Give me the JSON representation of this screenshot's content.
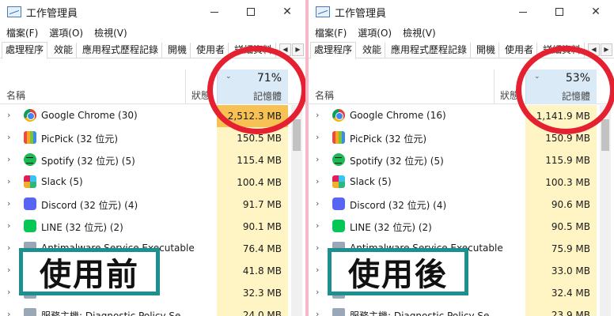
{
  "window": {
    "title": "工作管理員",
    "minimize_glyph": "—",
    "close_glyph": "✕"
  },
  "menu": [
    "檔案(F)",
    "選項(O)",
    "檢視(V)"
  ],
  "tabs": [
    "處理程序",
    "效能",
    "應用程式歷程記錄",
    "開機",
    "使用者",
    "詳細資料"
  ],
  "columns": {
    "name": "名稱",
    "status": "狀態",
    "memory": "記憶體"
  },
  "colors": {
    "memory_header": "#dbeaf7",
    "memory_cell": "#fff4c4",
    "memory_cell_hot": "#f7c253",
    "circle": "#e52030",
    "stamp_border": "#1d8f8f",
    "divider": "#f6b8c8"
  },
  "panels": [
    {
      "memory_percent": "71%",
      "label": "使用前",
      "processes": [
        {
          "name": "Google Chrome (30)",
          "memory": "2,512.3 MB",
          "icon": "chrome-icon",
          "hot": true
        },
        {
          "name": "PicPick (32 位元)",
          "memory": "150.5 MB",
          "icon": "picpick-icon",
          "hot": false
        },
        {
          "name": "Spotify (32 位元) (5)",
          "memory": "115.4 MB",
          "icon": "spotify-icon",
          "hot": false
        },
        {
          "name": "Slack (5)",
          "memory": "100.4 MB",
          "icon": "slack-icon",
          "hot": false
        },
        {
          "name": "Discord (32 位元) (4)",
          "memory": "91.7 MB",
          "icon": "discord-icon",
          "hot": false
        },
        {
          "name": "LINE (32 位元) (2)",
          "memory": "90.1 MB",
          "icon": "line-icon",
          "hot": false
        },
        {
          "name": "Antimalware Service Executable",
          "memory": "76.4 MB",
          "icon": "generic-icon",
          "hot": false
        },
        {
          "name": "",
          "memory": "41.8 MB",
          "icon": "generic-icon",
          "hot": false
        },
        {
          "name": "",
          "memory": "32.3 MB",
          "icon": "generic-icon",
          "hot": false
        },
        {
          "name": "服務主機: Diagnostic Policy Se",
          "memory": "24.0 MB",
          "icon": "generic-icon",
          "hot": false
        }
      ]
    },
    {
      "memory_percent": "53%",
      "label": "使用後",
      "processes": [
        {
          "name": "Google Chrome (16)",
          "memory": "1,141.9 MB",
          "icon": "chrome-icon",
          "hot": false
        },
        {
          "name": "PicPick (32 位元)",
          "memory": "150.9 MB",
          "icon": "picpick-icon",
          "hot": false
        },
        {
          "name": "Spotify (32 位元) (5)",
          "memory": "115.9 MB",
          "icon": "spotify-icon",
          "hot": false
        },
        {
          "name": "Slack (5)",
          "memory": "100.3 MB",
          "icon": "slack-icon",
          "hot": false
        },
        {
          "name": "Discord (32 位元) (4)",
          "memory": "90.6 MB",
          "icon": "discord-icon",
          "hot": false
        },
        {
          "name": "LINE (32 位元) (2)",
          "memory": "90.5 MB",
          "icon": "line-icon",
          "hot": false
        },
        {
          "name": "Antimalware Service Executable",
          "memory": "75.9 MB",
          "icon": "generic-icon",
          "hot": false
        },
        {
          "name": "",
          "memory": "33.0 MB",
          "icon": "generic-icon",
          "hot": false
        },
        {
          "name": "",
          "memory": "32.4 MB",
          "icon": "generic-icon",
          "hot": false
        },
        {
          "name": "服務主機: Diagnostic Policy Se",
          "memory": "23.9 MB",
          "icon": "generic-icon",
          "hot": false
        }
      ]
    }
  ]
}
